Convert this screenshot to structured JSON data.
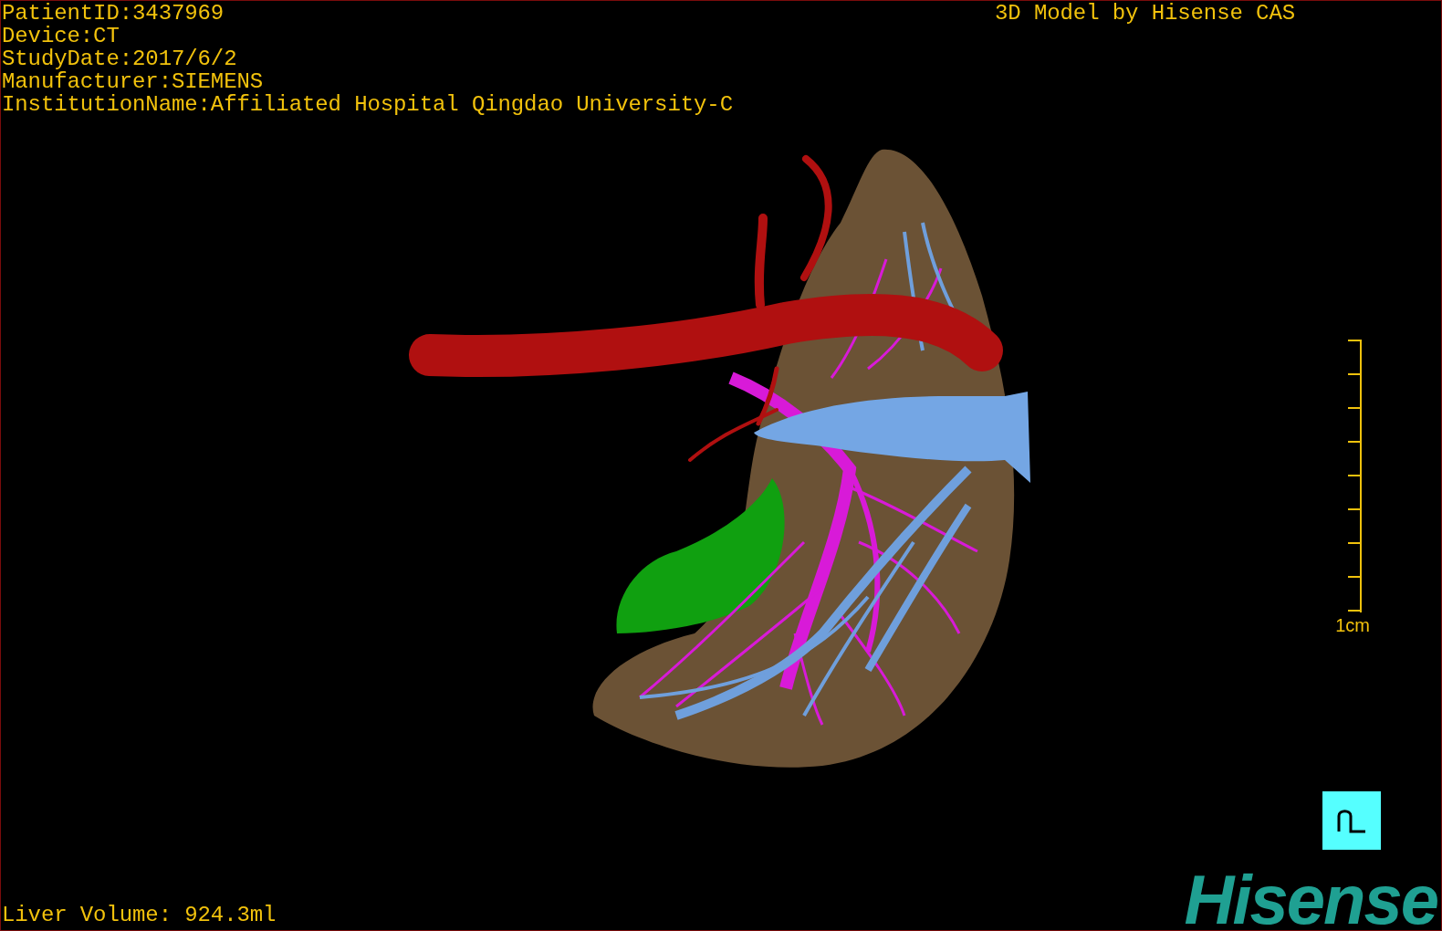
{
  "info_lines": [
    "PatientID:3437969",
    "Device:CT",
    "StudyDate:2017/6/2",
    "Manufacturer:SIEMENS",
    "InstitutionName:Affiliated Hospital Qingdao University-C"
  ],
  "title": "3D Model by Hisense CAS",
  "scale_bar": {
    "label": "1cm"
  },
  "liver_volume": "Liver Volume: 924.3ml",
  "logo": "Hisense"
}
